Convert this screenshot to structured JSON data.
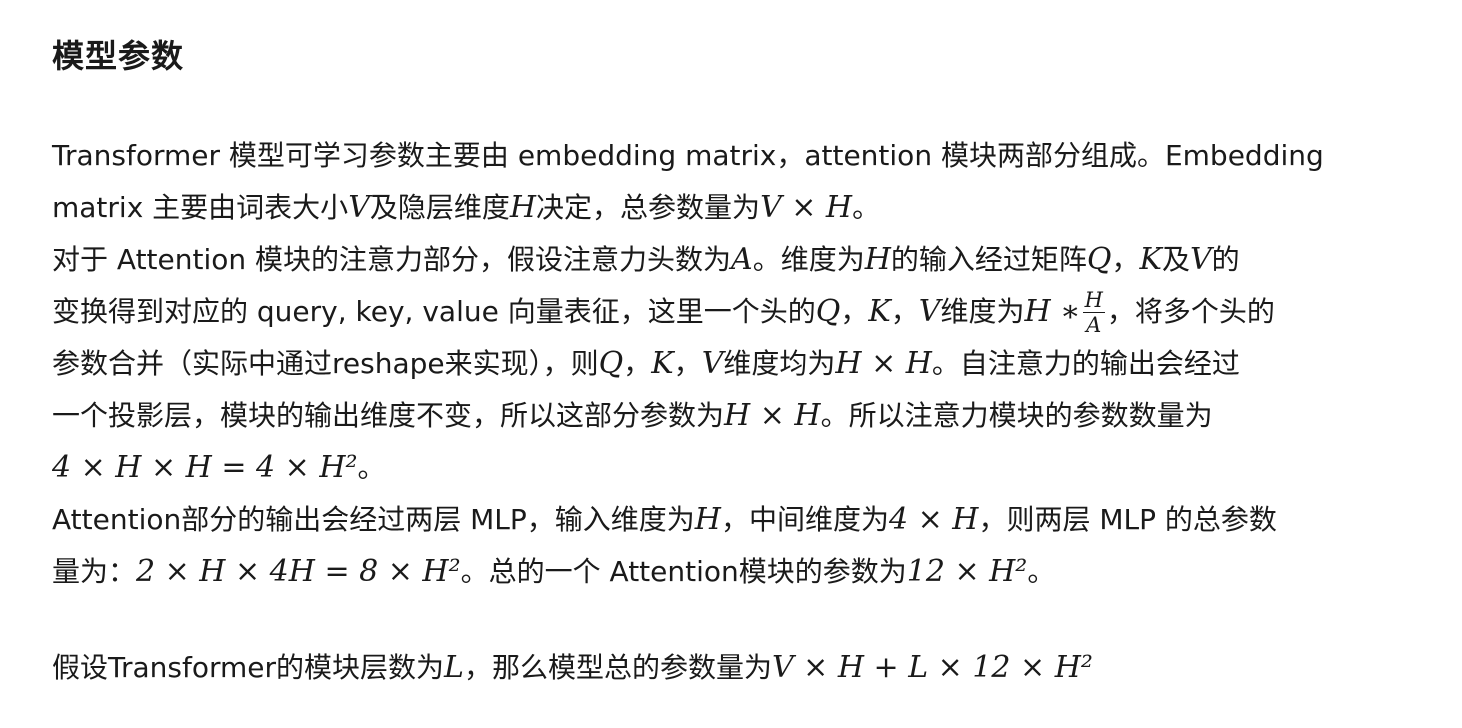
{
  "title": "模型参数",
  "paragraph1": {
    "line1": "Transformer 模型可学习参数主要由 embedding matrix，attention 模块两部分组成。Embedding",
    "line2_a": "matrix 主要由词表大小",
    "line2_m1": "V",
    "line2_b": "及隐层维度",
    "line2_m2": "H",
    "line2_c": "决定，总参数量为",
    "line2_m3": "V × H",
    "line2_d": "。"
  },
  "paragraph2": {
    "line1_a": "对于 Attention 模块的注意力部分，假设注意力头数为",
    "line1_m1": "A",
    "line1_b": "。维度为",
    "line1_m2": "H",
    "line1_c": "的输入经过矩阵",
    "line1_m3": "Q",
    "line1_d": "，",
    "line1_m4": "K",
    "line1_e": "及",
    "line1_m5": "V",
    "line1_f": "的",
    "line2_a": "变换得到对应的 query, key, value 向量表征，这里一个头的",
    "line2_m1": "Q",
    "line2_b": "，",
    "line2_m2": "K",
    "line2_c": "，",
    "line2_m3": "V",
    "line2_d": "维度为",
    "line2_m4": "H ∗",
    "line2_frac_num": "H",
    "line2_frac_den": "A",
    "line2_e": "，将多个头的",
    "line3_a": "参数合并（实际中通过reshape来实现），则",
    "line3_m1": "Q",
    "line3_b": "，",
    "line3_m2": "K",
    "line3_c": "，",
    "line3_m3": "V",
    "line3_d": "维度均为",
    "line3_m4": "H × H",
    "line3_e": "。自注意力的输出会经过",
    "line4_a": "一个投影层，模块的输出维度不变，所以这部分参数为",
    "line4_m1": "H × H",
    "line4_b": "。所以注意力模块的参数数量为",
    "line5_m1": "4 × H × H = 4 × H²",
    "line5_a": "。"
  },
  "paragraph3": {
    "line1_a": "Attention部分的输出会经过两层 MLP，输入维度为",
    "line1_m1": "H",
    "line1_b": "，中间维度为",
    "line1_m2": "4 × H",
    "line1_c": "，则两层 MLP 的总参数",
    "line2_a": "量为：",
    "line2_m1": "2 × H × 4H = 8 × H²",
    "line2_b": "。总的一个 Attention模块的参数为",
    "line2_m2": "12 × H²",
    "line2_c": "。"
  },
  "paragraph4": {
    "a": "假设Transformer的模块层数为",
    "m1": "L",
    "b": "，那么模型总的参数量为",
    "m2": "V × H + L × 12 × H²"
  }
}
